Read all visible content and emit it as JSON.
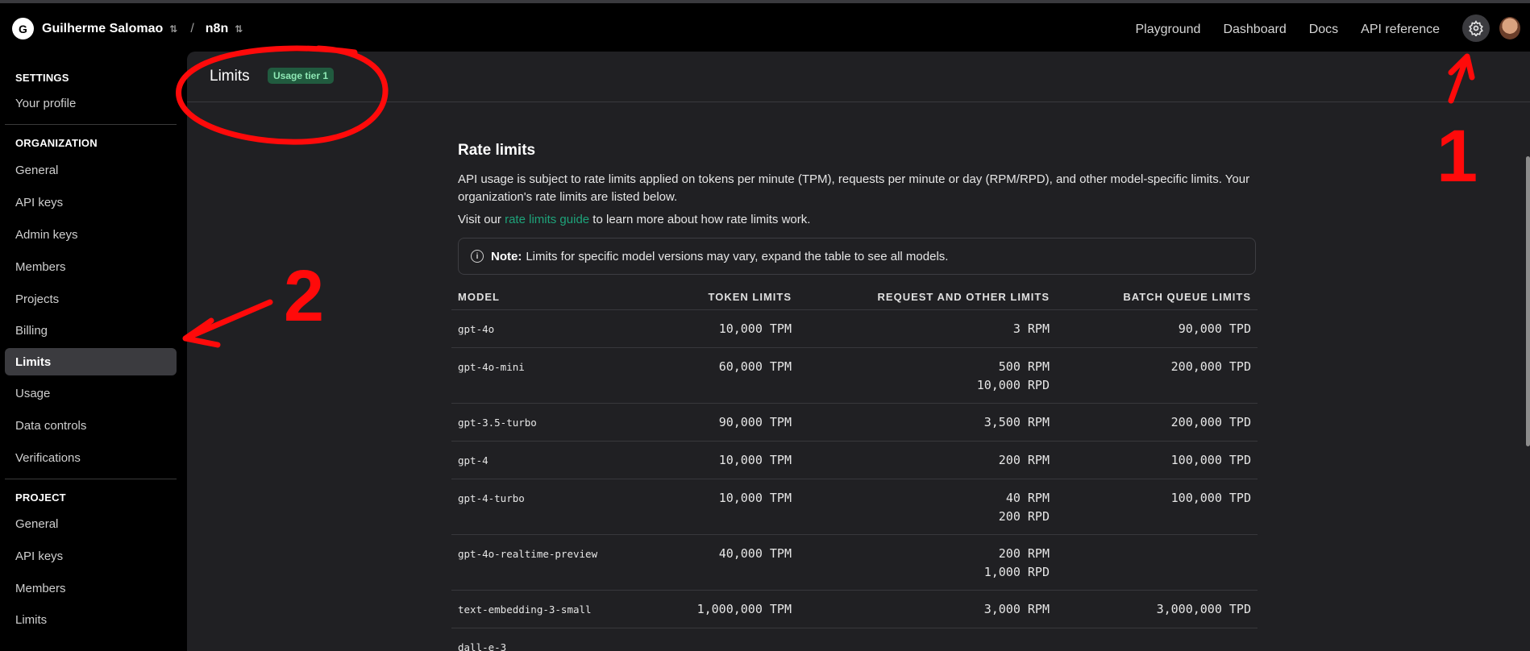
{
  "topbar": {
    "org_initial": "G",
    "org_name": "Guilherme Salomao",
    "separator": "/",
    "project_name": "n8n",
    "nav": [
      "Playground",
      "Dashboard",
      "Docs",
      "API reference"
    ]
  },
  "sidebar": {
    "settings_title": "SETTINGS",
    "your_profile": "Your profile",
    "organization_title": "ORGANIZATION",
    "org_items": [
      "General",
      "API keys",
      "Admin keys",
      "Members",
      "Projects",
      "Billing",
      "Limits",
      "Usage",
      "Data controls",
      "Verifications"
    ],
    "project_title": "PROJECT",
    "project_items": [
      "General",
      "API keys",
      "Members",
      "Limits"
    ]
  },
  "page": {
    "title": "Limits",
    "tier_badge": "Usage tier 1"
  },
  "rate_limits": {
    "title": "Rate limits",
    "description": "API usage is subject to rate limits applied on tokens per minute (TPM), requests per minute or day (RPM/RPD), and other model-specific limits. Your organization's rate limits are listed below.",
    "visit_prefix": "Visit our ",
    "guide_link": "rate limits guide",
    "visit_suffix": " to learn more about how rate limits work.",
    "note_label": "Note:",
    "note_text": "Limits for specific model versions may vary, expand the table to see all models.",
    "columns": [
      "MODEL",
      "TOKEN LIMITS",
      "REQUEST AND OTHER LIMITS",
      "BATCH QUEUE LIMITS"
    ],
    "rows": [
      {
        "model": "gpt-4o",
        "tokens": "10,000 TPM",
        "requests": [
          "3 RPM"
        ],
        "batch": "90,000 TPD"
      },
      {
        "model": "gpt-4o-mini",
        "tokens": "60,000 TPM",
        "requests": [
          "500 RPM",
          "10,000 RPD"
        ],
        "batch": "200,000 TPD"
      },
      {
        "model": "gpt-3.5-turbo",
        "tokens": "90,000 TPM",
        "requests": [
          "3,500 RPM"
        ],
        "batch": "200,000 TPD"
      },
      {
        "model": "gpt-4",
        "tokens": "10,000 TPM",
        "requests": [
          "200 RPM"
        ],
        "batch": "100,000 TPD"
      },
      {
        "model": "gpt-4-turbo",
        "tokens": "10,000 TPM",
        "requests": [
          "40 RPM",
          "200 RPD"
        ],
        "batch": "100,000 TPD"
      },
      {
        "model": "gpt-4o-realtime-preview",
        "tokens": "40,000 TPM",
        "requests": [
          "200 RPM",
          "1,000 RPD"
        ],
        "batch": ""
      },
      {
        "model": "text-embedding-3-small",
        "tokens": "1,000,000 TPM",
        "requests": [
          "3,000 RPM"
        ],
        "batch": "3,000,000 TPD"
      },
      {
        "model": "dall-e-3",
        "tokens": "",
        "requests": [],
        "batch": ""
      }
    ]
  },
  "annotations": {
    "label_1": "1",
    "label_2": "2",
    "color": "#ff0a0a"
  },
  "icons": {
    "settings": "gear-icon",
    "info": "info-icon",
    "chevron": "chevron-up-down-icon"
  }
}
